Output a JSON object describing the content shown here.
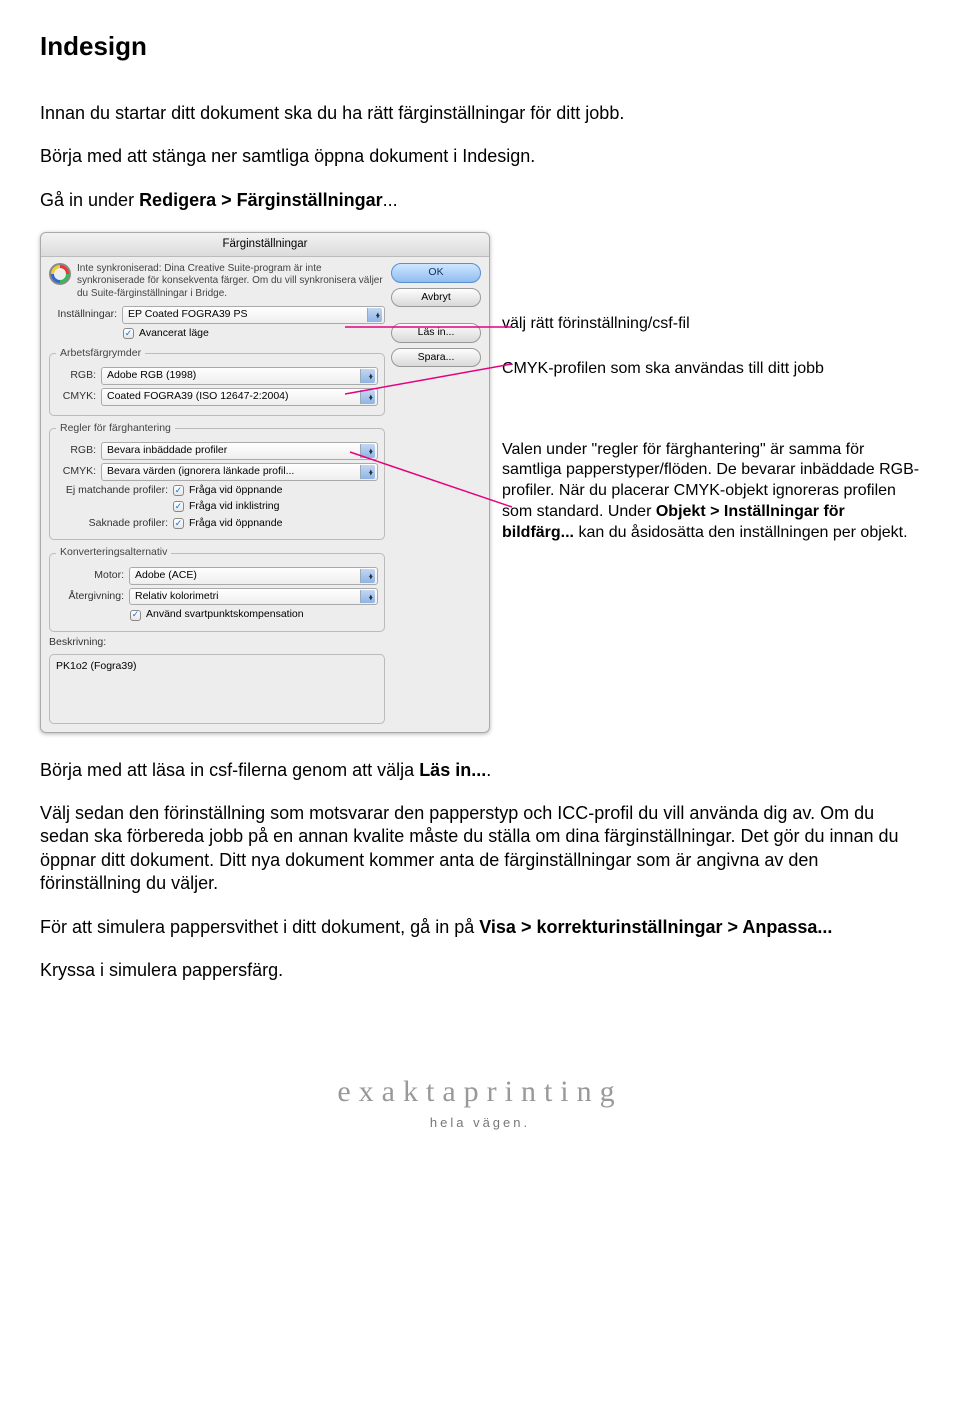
{
  "title": "Indesign",
  "intro": {
    "p1": "Innan du startar ditt dokument ska du ha rätt färginställningar för ditt jobb.",
    "p2": "Börja med att stänga ner samtliga öppna dokument i Indesign.",
    "p3_prefix": "Gå in under ",
    "p3_bold": "Redigera > Färginställningar",
    "p3_suffix": "..."
  },
  "dialog": {
    "title": "Färginställningar",
    "sync_text": "Inte synkroniserad: Dina Creative Suite-program är inte synkroniserade för konsekventa färger. Om du vill synkronisera väljer du Suite-färginställningar i Bridge.",
    "buttons": {
      "ok": "OK",
      "cancel": "Avbryt",
      "load": "Läs in...",
      "save": "Spara..."
    },
    "settings_label": "Inställningar:",
    "settings_value": "EP Coated FOGRA39 PS",
    "advanced_label": "Avancerat läge",
    "workspace": {
      "legend": "Arbetsfärgrymder",
      "rgb_label": "RGB:",
      "rgb_value": "Adobe RGB (1998)",
      "cmyk_label": "CMYK:",
      "cmyk_value": "Coated FOGRA39 (ISO 12647-2:2004)"
    },
    "policies": {
      "legend": "Regler för färghantering",
      "rgb_label": "RGB:",
      "rgb_value": "Bevara inbäddade profiler",
      "cmyk_label": "CMYK:",
      "cmyk_value": "Bevara värden (ignorera länkade profil...",
      "mismatch_label": "Ej matchande profiler:",
      "mismatch_open": "Fråga vid öppnande",
      "mismatch_paste": "Fråga vid inklistring",
      "missing_label": "Saknade profiler:",
      "missing_open": "Fråga vid öppnande"
    },
    "conversion": {
      "legend": "Konverteringsalternativ",
      "engine_label": "Motor:",
      "engine_value": "Adobe (ACE)",
      "intent_label": "Återgivning:",
      "intent_value": "Relativ kolorimetri",
      "bpc_label": "Använd svartpunktskompensation"
    },
    "description": {
      "label": "Beskrivning:",
      "value": "PK1o2 (Fogra39)"
    }
  },
  "annotations": {
    "a1": "välj rätt förinställning/csf-fil",
    "a2": "CMYK-profilen som ska användas till ditt jobb",
    "a3_p1": "Valen under \"regler för färghantering\" är samma för samtliga papperstyper/flöden. De bevarar inbäddade RGB-profiler. När du placerar CMYK-objekt ignoreras profilen som standard. Under ",
    "a3_bold": "Objekt > Inställningar för bildfärg...",
    "a3_p2": " kan du åsidosätta den inställningen per objekt."
  },
  "body": {
    "p1_prefix": "Börja med att läsa in csf-filerna genom att välja ",
    "p1_bold": "Läs in...",
    "p1_suffix": ".",
    "p2": "Välj sedan den förinställning som motsvarar den papperstyp och ICC-profil du vill använda dig av. Om du sedan ska förbereda jobb på en annan kvalite måste du ställa om dina färginställningar. Det gör du innan du öppnar ditt dokument. Ditt nya dokument kommer anta de färginställningar som är angivna av den förinställning du väljer.",
    "p3_prefix": "För att simulera pappersvithet i ditt dokument, gå in på ",
    "p3_bold": "Visa > korrekturinställningar > Anpassa...",
    "p4": "Kryssa i simulera pappersfärg."
  },
  "footer": {
    "brand1": "exakta",
    "brand2": "printing",
    "sub": "hela vägen."
  }
}
